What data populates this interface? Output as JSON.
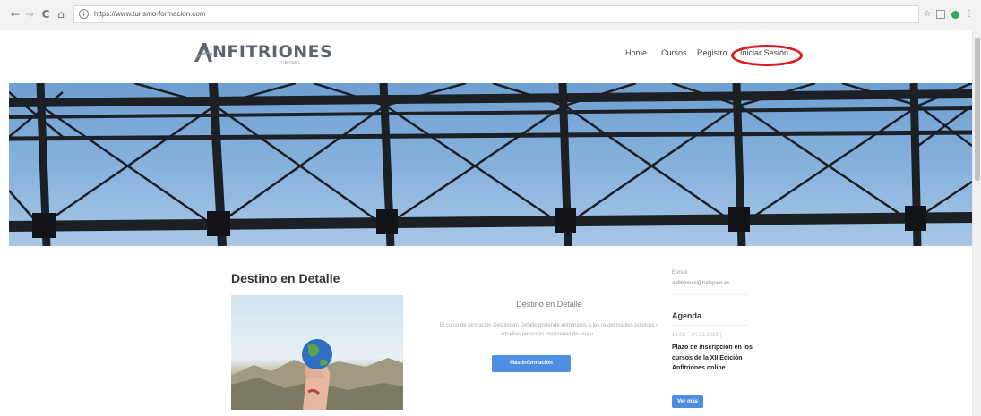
{
  "browser": {
    "back_glyph": "←",
    "forward_glyph": "→",
    "reload_glyph": "C",
    "home_glyph": "⌂",
    "info_glyph": "i",
    "url": "https://www.turismo-formacion.com",
    "star_glyph": "☆",
    "menu_glyph": "⋮"
  },
  "site": {
    "logo_text": "NFITRIONES",
    "logo_sub": "TURISMO",
    "nav": [
      {
        "label": "Home"
      },
      {
        "label": "Cursos"
      },
      {
        "label": "Registro"
      },
      {
        "label": "Iniciar Sesión"
      }
    ],
    "highlight_color": "#e0161f"
  },
  "main": {
    "section_title": "Destino en Detalle",
    "card": {
      "heading": "Destino en Detalle",
      "description": "El curso de formación Destino en Detalle pretende entrenaros a los responsables públicos o aquellas personas implicadas de una u...",
      "button_label": "Más Información"
    }
  },
  "sidebar": {
    "email_label": "E-mail",
    "email": "anfitriones@turispain.es",
    "agenda_title": "Agenda",
    "agenda_date": "14.02 – 24.02.2019 |",
    "agenda_event": "Plazo de inscripción en los cursos de la XII Edición Anfitriones online",
    "more_label": "Ver más"
  },
  "colors": {
    "accent_button": "#4f8de0",
    "sky": "#89b3de",
    "steel": "#1c1f24"
  },
  "icons": [
    "back-icon",
    "forward-icon",
    "reload-icon",
    "home-icon",
    "info-icon",
    "star-icon",
    "extension-icon",
    "menu-icon",
    "globe-icon"
  ]
}
